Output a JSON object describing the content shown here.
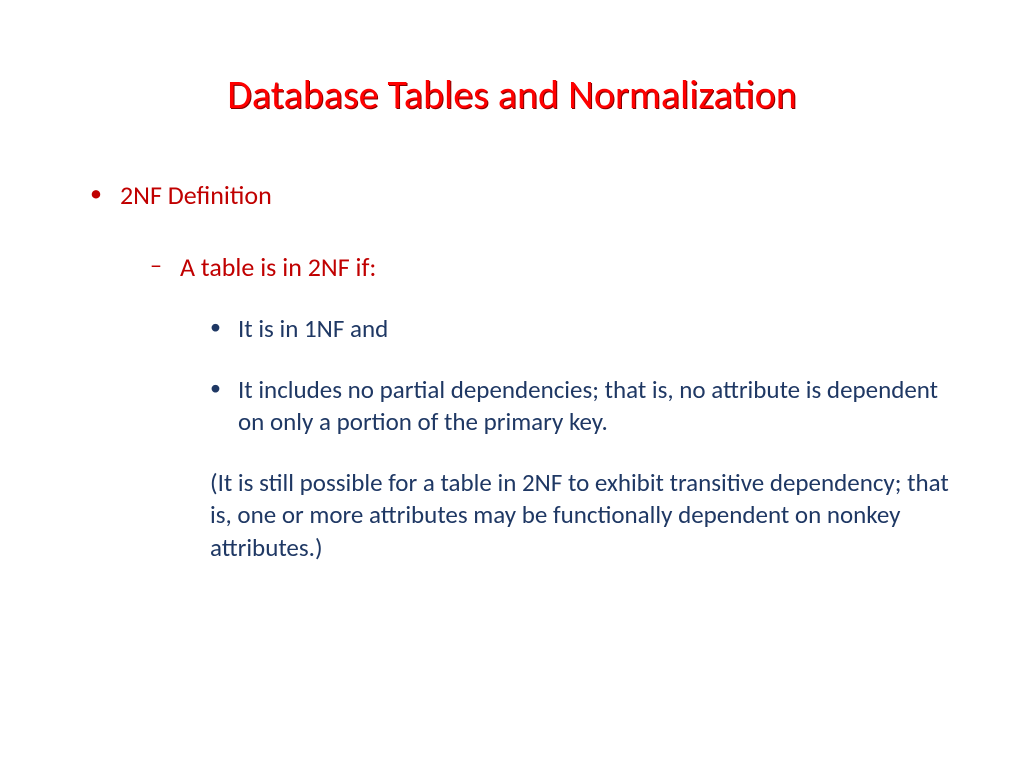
{
  "title": "Database Tables and Normalization",
  "level1_item": "2NF Definition",
  "level2_item": "A table is in 2NF if:",
  "level3_items": [
    "It is in 1NF and",
    "It includes no partial dependencies; that is, no attribute is dependent on only a portion of the primary key.",
    "(It is still possible for a table in 2NF to exhibit transitive dependency; that is, one or more attributes may be functionally dependent on nonkey attributes.)"
  ]
}
